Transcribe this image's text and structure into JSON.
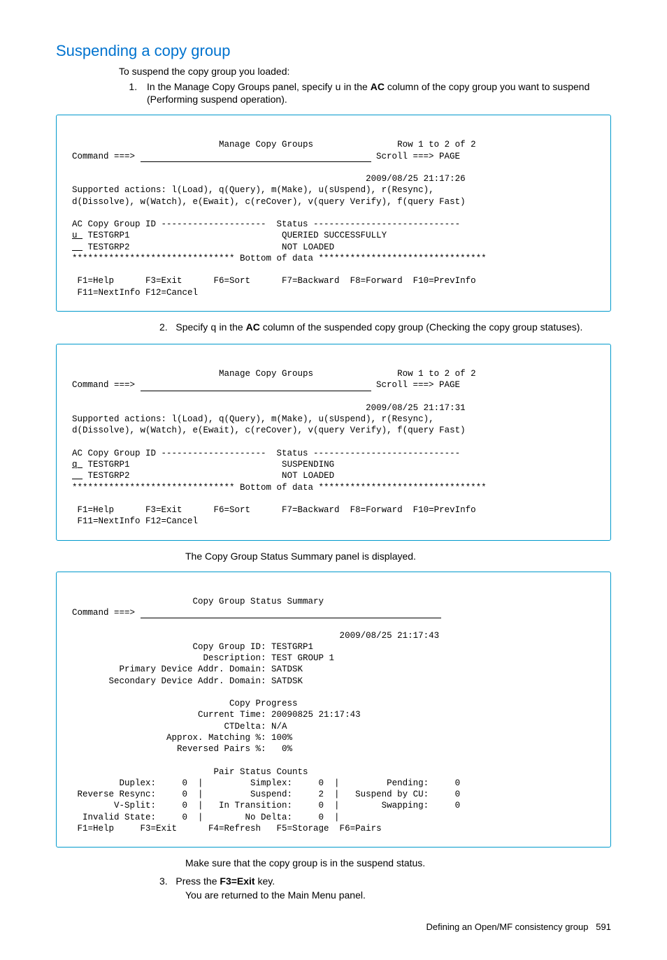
{
  "heading": "Suspending a copy group",
  "intro": "To suspend the copy group you loaded:",
  "step1_prefix": "In the Manage Copy Groups panel, specify ",
  "step1_code": "u",
  "step1_mid": " in the ",
  "step1_bold": "AC",
  "step1_suffix": " column of the copy group you want to suspend (Performing suspend operation).",
  "term1": {
    "title_line": "                            Manage Copy Groups                Row 1 to 2 of 2",
    "cmd_label": "Command ===> ",
    "scroll": " Scroll ===> PAGE",
    "ts": "                                                        2009/08/25 21:17:26",
    "actions1": "Supported actions: l(Load), q(Query), m(Make), u(sUspend), r(Resync),",
    "actions2": "d(Dissolve), w(Watch), e(Ewait), c(reCover), v(query Verify), f(query Fast)",
    "hdr": "AC Copy Group ID --------------------  Status ----------------------------",
    "r1_ac": "u ",
    "r1_rest": " TESTGRP1                             QUERIED SUCCESSFULLY",
    "r2_ac": "  ",
    "r2_rest": " TESTGRP2                             NOT LOADED",
    "bottom": "******************************* Bottom of data ********************************",
    "fk1": " F1=Help      F3=Exit      F6=Sort      F7=Backward  F8=Forward  F10=PrevInfo",
    "fk2": " F11=NextInfo F12=Cancel"
  },
  "step2_num": "2.",
  "step2_prefix": "Specify ",
  "step2_code": "q",
  "step2_mid": " in the ",
  "step2_bold": "AC",
  "step2_suffix": " column of the suspended copy group (Checking the copy group statuses).",
  "term2": {
    "title_line": "                            Manage Copy Groups                Row 1 to 2 of 2",
    "cmd_label": "Command ===> ",
    "scroll": " Scroll ===> PAGE",
    "ts": "                                                        2009/08/25 21:17:31",
    "actions1": "Supported actions: l(Load), q(Query), m(Make), u(sUspend), r(Resync),",
    "actions2": "d(Dissolve), w(Watch), e(Ewait), c(reCover), v(query Verify), f(query Fast)",
    "hdr": "AC Copy Group ID --------------------  Status ----------------------------",
    "r1_ac": "q ",
    "r1_rest": " TESTGRP1                             SUSPENDING",
    "r2_ac": "  ",
    "r2_rest": " TESTGRP2                             NOT LOADED",
    "bottom": "******************************* Bottom of data ********************************",
    "fk1": " F1=Help      F3=Exit      F6=Sort      F7=Backward  F8=Forward  F10=PrevInfo",
    "fk2": " F11=NextInfo F12=Cancel"
  },
  "after2": "The Copy Group Status Summary panel is displayed.",
  "term3": {
    "title_line": "                       Copy Group Status Summary",
    "cmd_label": "Command ===> ",
    "ts": "                                                   2009/08/25 21:17:43",
    "l1": "                       Copy Group ID: TESTGRP1",
    "l2": "                         Description: TEST GROUP 1",
    "l3": "         Primary Device Addr. Domain: SATDSK",
    "l4": "       Secondary Device Addr. Domain: SATDSK",
    "cp_title": "                              Copy Progress",
    "cp1": "                        Current Time: 20090825 21:17:43",
    "cp2": "                             CTDelta: N/A",
    "cp3": "                  Approx. Matching %: 100%",
    "cp4": "                    Reversed Pairs %:   0%",
    "psc_title": "                           Pair Status Counts",
    "psc1": "         Duplex:     0  |         Simplex:     0  |         Pending:     0",
    "psc2": " Reverse Resync:     0  |         Suspend:     2  |   Suspend by CU:     0",
    "psc3": "        V-Split:     0  |   In Transition:     0  |        Swapping:     0",
    "psc4": "  Invalid State:     0  |        No Delta:     0  |",
    "fk": " F1=Help     F3=Exit      F4=Refresh   F5=Storage  F6=Pairs"
  },
  "after3": "Make sure that the copy group is in the suspend status.",
  "step3_num": "3.",
  "step3_prefix": "Press the ",
  "step3_bold": "F3=Exit",
  "step3_suffix": " key.",
  "step3_result": "You are returned to the Main Menu panel.",
  "footer": "Defining an Open/MF consistency group",
  "page_num": "591"
}
